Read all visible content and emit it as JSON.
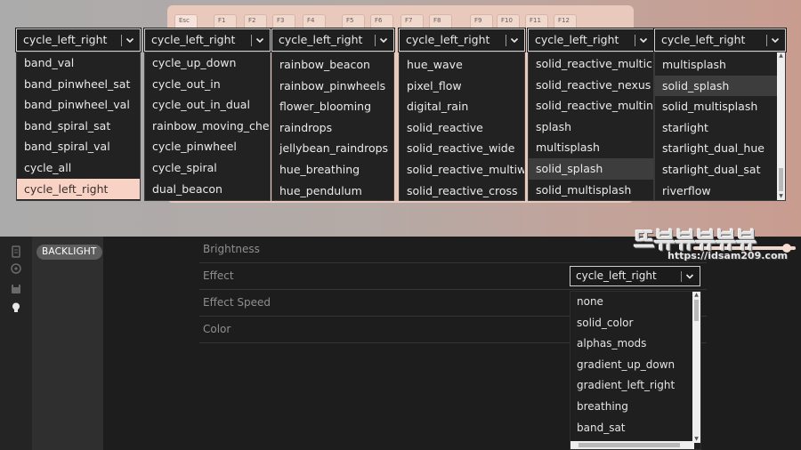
{
  "keyboard": {
    "keys": [
      "Esc",
      "F1",
      "F2",
      "F3",
      "F4",
      "F5",
      "F6",
      "F7",
      "F8",
      "F9",
      "F10",
      "F11",
      "F12"
    ]
  },
  "dropdowns": [
    {
      "selected": "cycle_left_right",
      "items": [
        "band_val",
        "band_pinwheel_sat",
        "band_pinwheel_val",
        "band_spiral_sat",
        "band_spiral_val",
        "cycle_all",
        "cycle_left_right"
      ],
      "highlighted_index": 6
    },
    {
      "selected": "cycle_left_right",
      "items": [
        "cycle_up_down",
        "cycle_out_in",
        "cycle_out_in_dual",
        "rainbow_moving_chevron",
        "cycle_pinwheel",
        "cycle_spiral",
        "dual_beacon"
      ],
      "highlighted_index": -1
    },
    {
      "selected": "cycle_left_right",
      "items": [
        "rainbow_beacon",
        "rainbow_pinwheels",
        "flower_blooming",
        "raindrops",
        "jellybean_raindrops",
        "hue_breathing",
        "hue_pendulum"
      ],
      "highlighted_index": -1
    },
    {
      "selected": "cycle_left_right",
      "items": [
        "hue_wave",
        "pixel_flow",
        "digital_rain",
        "solid_reactive",
        "solid_reactive_wide",
        "solid_reactive_multiwide",
        "solid_reactive_cross"
      ],
      "highlighted_index": -1
    },
    {
      "selected": "cycle_left_right",
      "items": [
        "solid_reactive_multicross",
        "solid_reactive_nexus",
        "solid_reactive_multinexus",
        "splash",
        "multisplash",
        "solid_splash",
        "solid_multisplash"
      ],
      "highlighted_index": 5
    },
    {
      "selected": "cycle_left_right",
      "items": [
        "multisplash",
        "solid_splash",
        "solid_multisplash",
        "starlight",
        "starlight_dual_hue",
        "starlight_dual_sat",
        "riverflow"
      ],
      "highlighted_index": 1
    }
  ],
  "sidebar": {
    "icons": [
      "file-icon",
      "circle-icon",
      "save-icon",
      "bulb-icon"
    ],
    "tab_label": "BACKLIGHT"
  },
  "settings": {
    "brightness_label": "Brightness",
    "brightness_value": 0.95,
    "effect_label": "Effect",
    "effect_value": "cycle_left_right",
    "effect_speed_label": "Effect Speed",
    "color_label": "Color"
  },
  "effect_list": [
    "none",
    "solid_color",
    "alphas_mods",
    "gradient_up_down",
    "gradient_left_right",
    "breathing",
    "band_sat"
  ],
  "watermark": {
    "logo": "뜨뷰뷰뷰뷰뷰",
    "url": "https://idsam209.com"
  },
  "colors": {
    "accent_pink": "#f8d3c5",
    "panel_dark": "#1f1f1f",
    "text_light": "#eaeaea"
  }
}
